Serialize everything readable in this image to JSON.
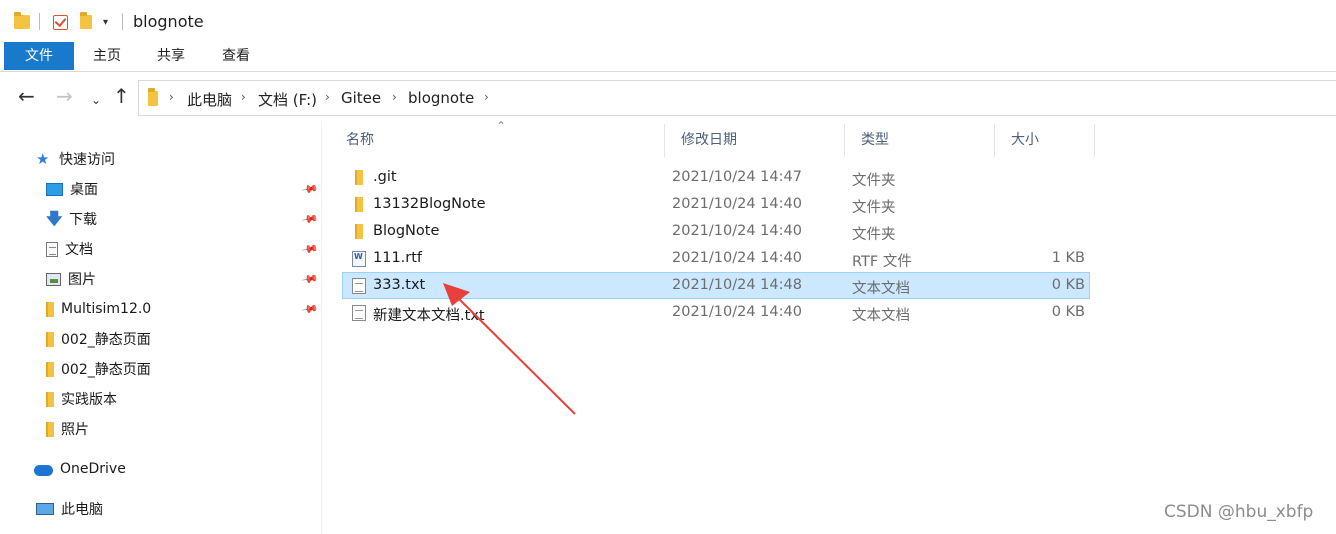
{
  "title": {
    "quick_access_icons": [
      "folder-icon",
      "properties-check-icon",
      "new-folder-icon",
      "customize-dropdown-icon"
    ],
    "window_title": "blognote"
  },
  "ribbon": {
    "tabs": [
      {
        "label": "文件",
        "active": true
      },
      {
        "label": "主页"
      },
      {
        "label": "共享"
      },
      {
        "label": "查看"
      }
    ],
    "active_color": "#1979ca"
  },
  "address": {
    "breadcrumbs": [
      "此电脑",
      "文档 (F:)",
      "Gitee",
      "blognote"
    ]
  },
  "sidebar": {
    "quick_access_label": "快速访问",
    "items": [
      {
        "label": "桌面",
        "icon": "desktop-icon",
        "pinned": true
      },
      {
        "label": "下载",
        "icon": "download-icon",
        "pinned": true
      },
      {
        "label": "文档",
        "icon": "document-icon",
        "pinned": true
      },
      {
        "label": "图片",
        "icon": "picture-icon",
        "pinned": true
      },
      {
        "label": "Multisim12.0",
        "icon": "folder-icon",
        "pinned": true
      },
      {
        "label": "002_静态页面",
        "icon": "folder-icon"
      },
      {
        "label": "002_静态页面",
        "icon": "folder-icon"
      },
      {
        "label": "实践版本",
        "icon": "folder-icon"
      },
      {
        "label": "照片",
        "icon": "folder-icon"
      }
    ],
    "onedrive_label": "OneDrive",
    "this_pc_label": "此电脑"
  },
  "file_list": {
    "columns": [
      "名称",
      "修改日期",
      "类型",
      "大小"
    ],
    "rows": [
      {
        "name": ".git",
        "date": "2021/10/24 14:47",
        "type": "文件夹",
        "size": "",
        "icon": "folder-icon"
      },
      {
        "name": "13132BlogNote",
        "date": "2021/10/24 14:40",
        "type": "文件夹",
        "size": "",
        "icon": "folder-icon"
      },
      {
        "name": "BlogNote",
        "date": "2021/10/24 14:40",
        "type": "文件夹",
        "size": "",
        "icon": "folder-icon"
      },
      {
        "name": "111.rtf",
        "date": "2021/10/24 14:40",
        "type": "RTF 文件",
        "size": "1 KB",
        "icon": "rtf-file-icon"
      },
      {
        "name": "333.txt",
        "date": "2021/10/24 14:48",
        "type": "文本文档",
        "size": "0 KB",
        "icon": "text-file-icon",
        "selected": true
      },
      {
        "name": "新建文本文档.txt",
        "date": "2021/10/24 14:40",
        "type": "文本文档",
        "size": "0 KB",
        "icon": "text-file-icon"
      }
    ],
    "selection_color": "#cce8ff"
  },
  "annotation": {
    "arrow_color": "#e8413c"
  },
  "watermark": "CSDN @hbu_xbfp"
}
